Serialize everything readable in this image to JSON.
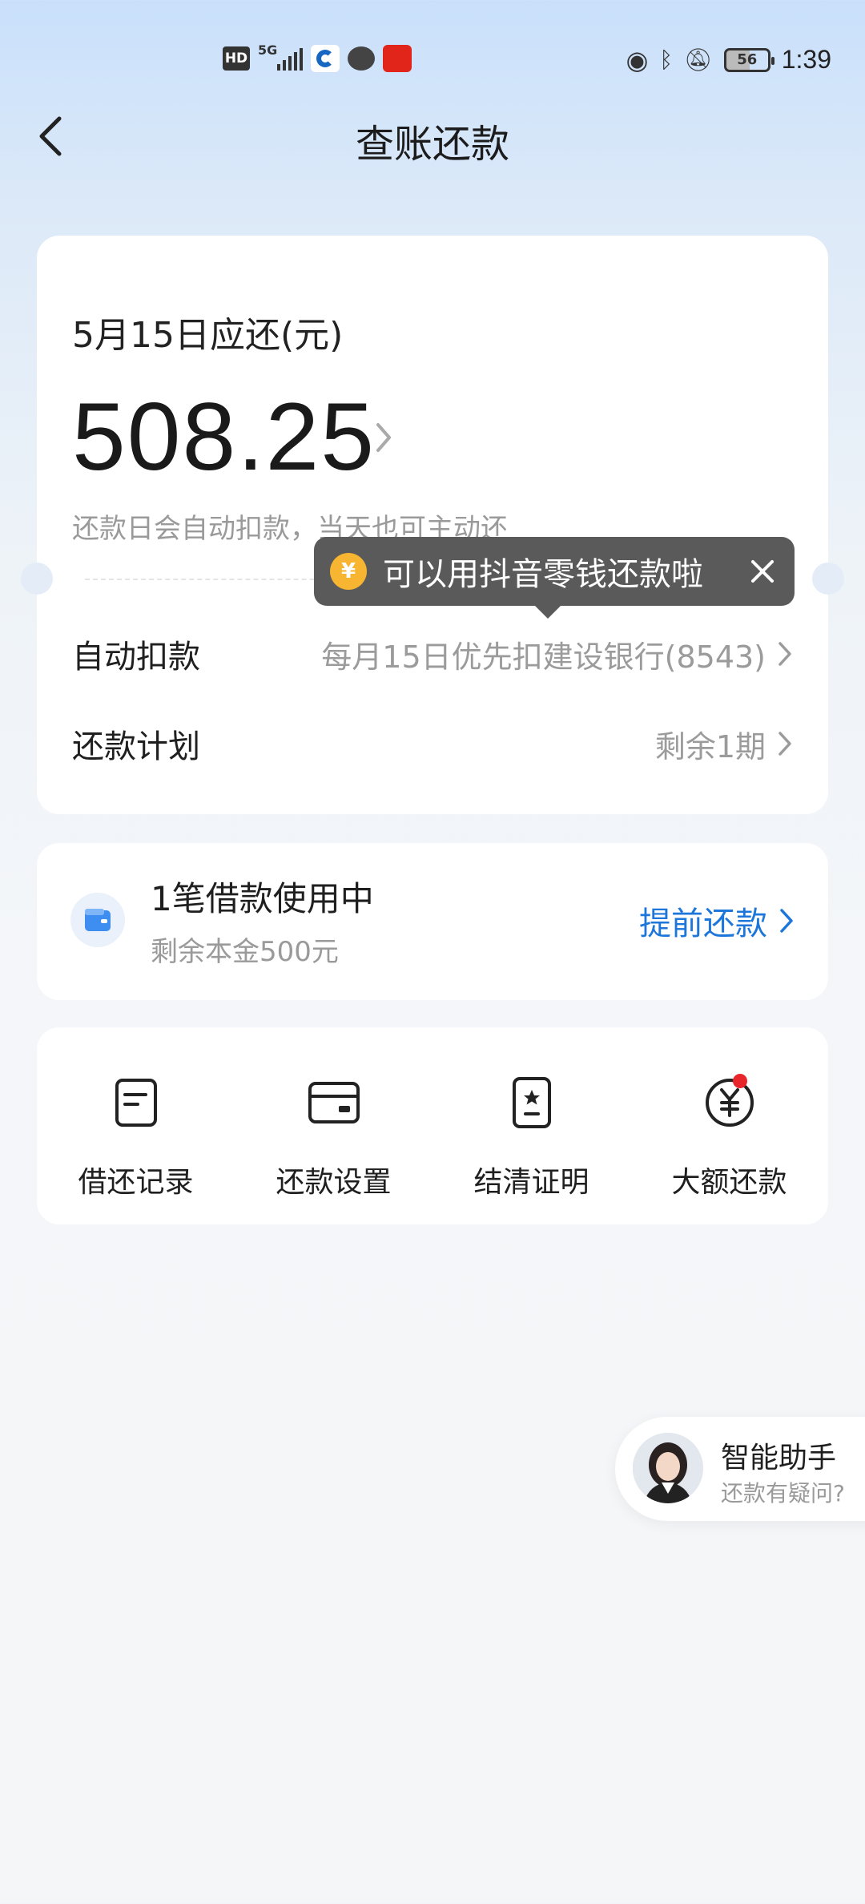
{
  "status_bar": {
    "time": "1:39",
    "battery": "56",
    "hd": "HD",
    "network": "5G"
  },
  "nav": {
    "title": "查账还款"
  },
  "bill": {
    "due_label": "5月15日应还(元)",
    "amount": "508.25",
    "note": "还款日会自动扣款，当天也可主动还"
  },
  "tooltip": {
    "coin": "¥",
    "text": "可以用抖音零钱还款啦"
  },
  "rows": {
    "auto_label": "自动扣款",
    "auto_value": "每月15日优先扣建设银行(8543)",
    "plan_label": "还款计划",
    "plan_value": "剩余1期"
  },
  "loan": {
    "title": "1笔借款使用中",
    "subtitle": "剩余本金500元",
    "action": "提前还款"
  },
  "grid": [
    {
      "label": "借还记录",
      "icon": "document-icon"
    },
    {
      "label": "还款设置",
      "icon": "card-icon"
    },
    {
      "label": "结清证明",
      "icon": "certificate-icon"
    },
    {
      "label": "大额还款",
      "icon": "yuan-icon"
    }
  ],
  "assistant": {
    "title": "智能助手",
    "subtitle": "还款有疑问?"
  },
  "colors": {
    "accent": "#1d76d9",
    "coin": "#f7b531",
    "badge": "#e8252b"
  }
}
